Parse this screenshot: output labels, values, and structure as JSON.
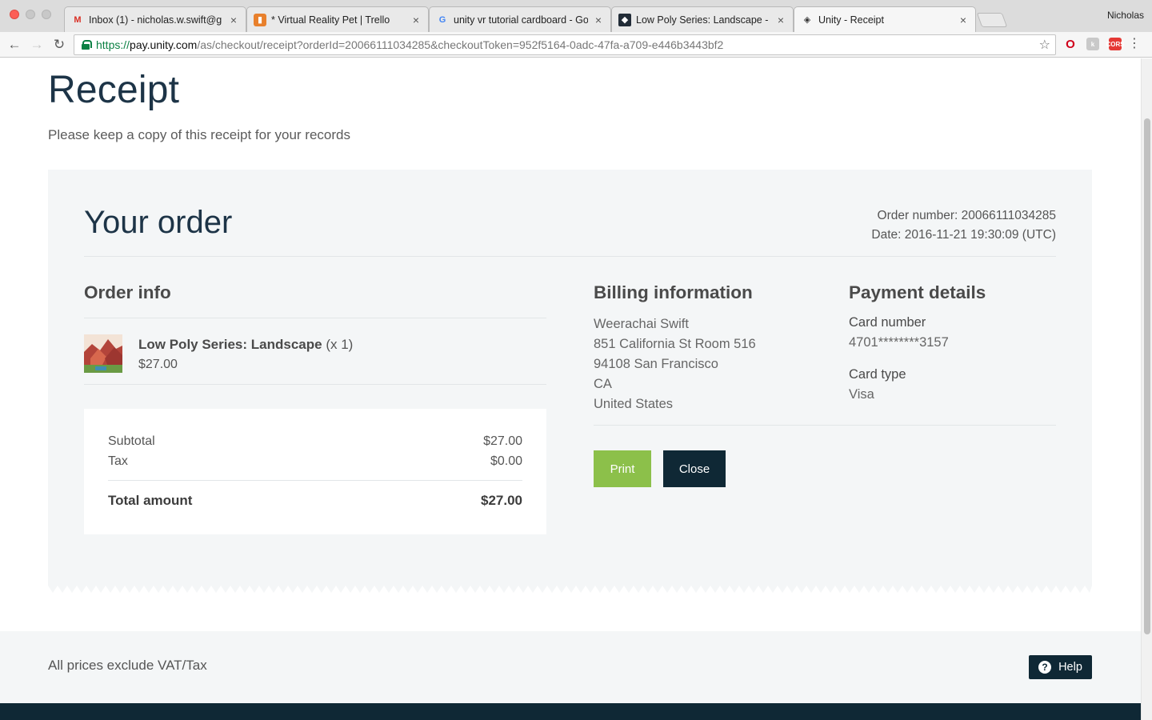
{
  "browser": {
    "profile_name": "Nicholas",
    "tabs": [
      {
        "title": "Inbox (1) - nicholas.w.swift@g",
        "icon": "gmail-icon"
      },
      {
        "title": "* Virtual Reality Pet | Trello",
        "icon": "trello-icon"
      },
      {
        "title": "unity vr tutorial cardboard - Go",
        "icon": "google-icon"
      },
      {
        "title": "Low Poly Series: Landscape - A",
        "icon": "unity-icon"
      },
      {
        "title": "Unity - Receipt",
        "icon": "unity-icon"
      }
    ],
    "active_tab_index": 4,
    "url": {
      "scheme": "https://",
      "host": "pay.unity.com",
      "path": "/as/checkout/receipt?orderId=20066111034285&checkoutToken=952f5164-0adc-47fa-a709-e446b3443bf2"
    }
  },
  "page": {
    "title": "Receipt",
    "subtitle": "Please keep a copy of this receipt for your records"
  },
  "order": {
    "heading": "Your order",
    "order_number_text": "Order number: 20066111034285",
    "date_text": "Date: 2016-11-21 19:30:09 (UTC)"
  },
  "order_info": {
    "heading": "Order info",
    "items": [
      {
        "name": "Low Poly Series: Landscape",
        "qty": "(x 1)",
        "price": "$27.00"
      }
    ],
    "subtotal_label": "Subtotal",
    "subtotal_value": "$27.00",
    "tax_label": "Tax",
    "tax_value": "$0.00",
    "total_label": "Total amount",
    "total_value": "$27.00"
  },
  "billing": {
    "heading": "Billing information",
    "name": "Weerachai Swift",
    "street": "851 California St Room 516",
    "city": "94108 San Francisco",
    "state": "CA",
    "country": "United States"
  },
  "payment": {
    "heading": "Payment details",
    "card_number_label": "Card number",
    "card_number_value": "4701********3157",
    "card_type_label": "Card type",
    "card_type_value": "Visa"
  },
  "actions": {
    "print_label": "Print",
    "close_label": "Close"
  },
  "footer": {
    "note": "All prices exclude VAT/Tax",
    "help_label": "Help"
  },
  "colors": {
    "accent_green": "#8cc04a",
    "dark_navy": "#0f2835",
    "panel_bg": "#f4f6f7"
  }
}
